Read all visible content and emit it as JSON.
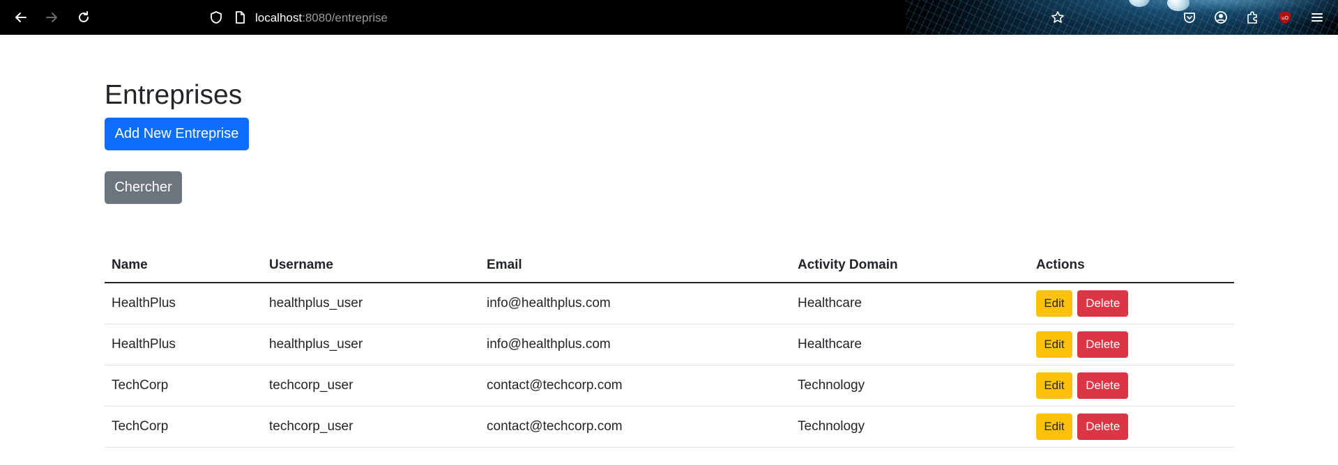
{
  "browser": {
    "url_host": "localhost",
    "url_path": ":8080/entreprise"
  },
  "page": {
    "title": "Entreprises",
    "add_button_label": "Add New Entreprise",
    "search_button_label": "Chercher"
  },
  "table": {
    "headers": [
      "Name",
      "Username",
      "Email",
      "Activity Domain",
      "Actions"
    ],
    "rows": [
      {
        "name": "HealthPlus",
        "username": "healthplus_user",
        "email": "info@healthplus.com",
        "domain": "Healthcare",
        "edit": "Edit",
        "delete": "Delete"
      },
      {
        "name": "HealthPlus",
        "username": "healthplus_user",
        "email": "info@healthplus.com",
        "domain": "Healthcare",
        "edit": "Edit",
        "delete": "Delete"
      },
      {
        "name": "TechCorp",
        "username": "techcorp_user",
        "email": "contact@techcorp.com",
        "domain": "Technology",
        "edit": "Edit",
        "delete": "Delete"
      },
      {
        "name": "TechCorp",
        "username": "techcorp_user",
        "email": "contact@techcorp.com",
        "domain": "Technology",
        "edit": "Edit",
        "delete": "Delete"
      }
    ]
  },
  "colors": {
    "primary": "#0d6efd",
    "secondary": "#6c757d",
    "warning": "#ffc107",
    "danger": "#dc3545"
  },
  "icons": [
    "back-arrow-icon",
    "forward-arrow-icon",
    "reload-icon",
    "shield-icon",
    "page-icon",
    "bookmark-star-icon",
    "pocket-icon",
    "account-icon",
    "extensions-icon",
    "ublock-icon",
    "menu-icon"
  ]
}
